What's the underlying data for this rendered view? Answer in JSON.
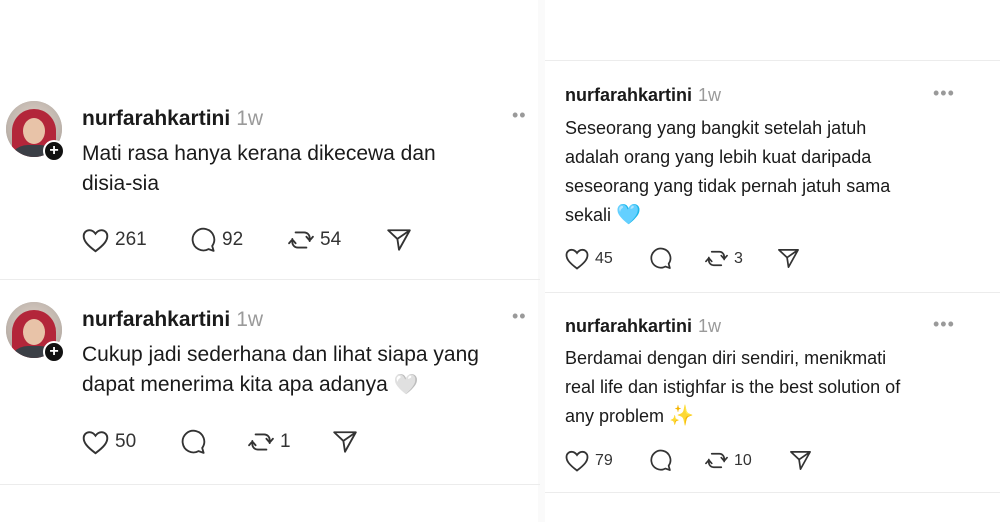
{
  "left_posts": [
    {
      "username": "nurfarahkartini",
      "time": "1w",
      "text_lines": [
        "Mati rasa hanya kerana dikecewa dan",
        "disia-sia"
      ],
      "likes": "261",
      "comments": "92",
      "reposts": "54"
    },
    {
      "username": "nurfarahkartini",
      "time": "1w",
      "text_lines": [
        "Cukup jadi sederhana dan lihat siapa yang",
        "dapat menerima kita apa adanya"
      ],
      "emoji": "🤍",
      "likes": "50",
      "comments": "",
      "reposts": "1"
    }
  ],
  "right_posts": [
    {
      "username": "nurfarahkartini",
      "time": "1w",
      "text_lines": [
        "Seseorang yang bangkit setelah jatuh",
        "adalah orang yang lebih kuat daripada",
        "seseorang yang tidak pernah jatuh sama",
        "sekali"
      ],
      "emoji": "🩵",
      "likes": "45",
      "comments": "",
      "reposts": "3"
    },
    {
      "username": "nurfarahkartini",
      "time": "1w",
      "text_lines": [
        "Berdamai dengan diri sendiri, menikmati",
        "real life dan istighfar is the best solution of",
        "any problem"
      ],
      "emoji": "✨",
      "likes": "79",
      "comments": "",
      "reposts": "10"
    }
  ],
  "more_label": "•••"
}
